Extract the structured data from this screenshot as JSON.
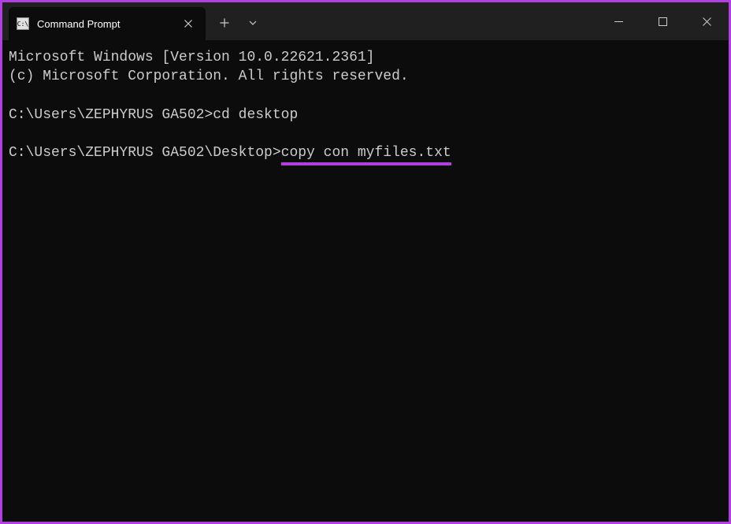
{
  "titlebar": {
    "tab_title": "Command Prompt"
  },
  "terminal": {
    "header_line1": "Microsoft Windows [Version 10.0.22621.2361]",
    "header_line2": "(c) Microsoft Corporation. All rights reserved.",
    "prompt1": "C:\\Users\\ZEPHYRUS GA502>",
    "command1": "cd desktop",
    "prompt2": "C:\\Users\\ZEPHYRUS GA502\\Desktop>",
    "command2": "copy con myfiles.txt"
  },
  "colors": {
    "accent": "#b040e0",
    "bg": "#0c0c0c",
    "titlebar": "#202020",
    "text": "#cccccc"
  }
}
